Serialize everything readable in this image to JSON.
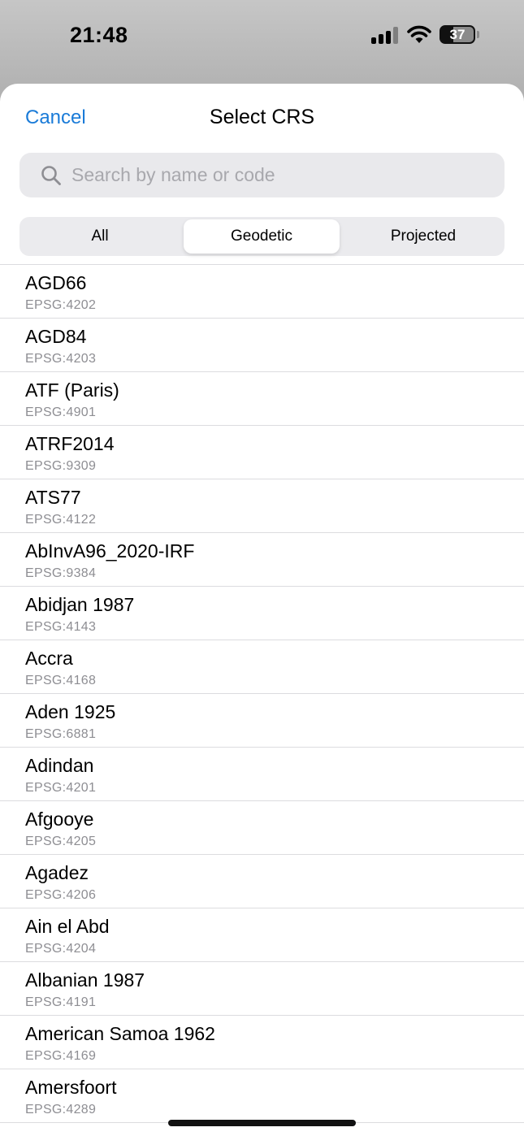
{
  "status_bar": {
    "time": "21:48",
    "battery_percent": "37",
    "battery_level": 0.37,
    "signal_bars": 3,
    "icons": [
      "signal-icon",
      "wifi-icon",
      "battery-icon"
    ]
  },
  "nav": {
    "cancel_label": "Cancel",
    "title": "Select CRS"
  },
  "search": {
    "placeholder": "Search by name or code",
    "value": ""
  },
  "segments": {
    "items": [
      "All",
      "Geodetic",
      "Projected"
    ],
    "selected": "Geodetic"
  },
  "crs_list": [
    {
      "name": "AGD66",
      "code": "EPSG:4202"
    },
    {
      "name": "AGD84",
      "code": "EPSG:4203"
    },
    {
      "name": "ATF (Paris)",
      "code": "EPSG:4901"
    },
    {
      "name": "ATRF2014",
      "code": "EPSG:9309"
    },
    {
      "name": "ATS77",
      "code": "EPSG:4122"
    },
    {
      "name": "AbInvA96_2020-IRF",
      "code": "EPSG:9384"
    },
    {
      "name": "Abidjan 1987",
      "code": "EPSG:4143"
    },
    {
      "name": "Accra",
      "code": "EPSG:4168"
    },
    {
      "name": "Aden 1925",
      "code": "EPSG:6881"
    },
    {
      "name": "Adindan",
      "code": "EPSG:4201"
    },
    {
      "name": "Afgooye",
      "code": "EPSG:4205"
    },
    {
      "name": "Agadez",
      "code": "EPSG:4206"
    },
    {
      "name": "Ain el Abd",
      "code": "EPSG:4204"
    },
    {
      "name": "Albanian 1987",
      "code": "EPSG:4191"
    },
    {
      "name": "American Samoa 1962",
      "code": "EPSG:4169"
    },
    {
      "name": "Amersfoort",
      "code": "EPSG:4289"
    }
  ],
  "colors": {
    "accent": "#1a7bd8",
    "secondary_text": "#8e8e93",
    "separator": "#dcdcdf"
  }
}
